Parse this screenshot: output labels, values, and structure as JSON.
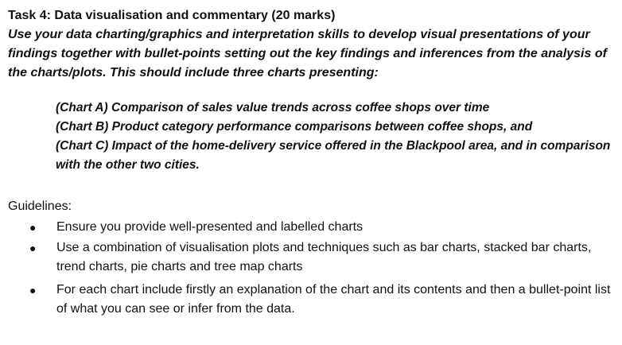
{
  "task": {
    "title": "Task 4: Data visualisation and commentary (20 marks)",
    "intro": "Use your data charting/graphics and interpretation skills to develop visual presentations of your findings together with bullet-points setting out the key findings and inferences from the analysis of the charts/plots.  This should include three charts presenting:"
  },
  "charts": [
    "(Chart A) Comparison of sales value trends across coffee shops over time",
    "(Chart B) Product category performance comparisons between coffee shops, and",
    "(Chart C) Impact of the home-delivery service offered in the Blackpool area, and in comparison with the other two cities."
  ],
  "guidelines": {
    "heading": "Guidelines:",
    "bullet_glyph": "●",
    "items": [
      "Ensure you provide well-presented and labelled charts",
      "Use a combination of visualisation plots and techniques such as bar charts, stacked bar charts, trend charts, pie charts and tree map charts",
      "For each chart include firstly an explanation of the chart and its contents and then a bullet-point list of what you can see or infer from the data."
    ]
  }
}
